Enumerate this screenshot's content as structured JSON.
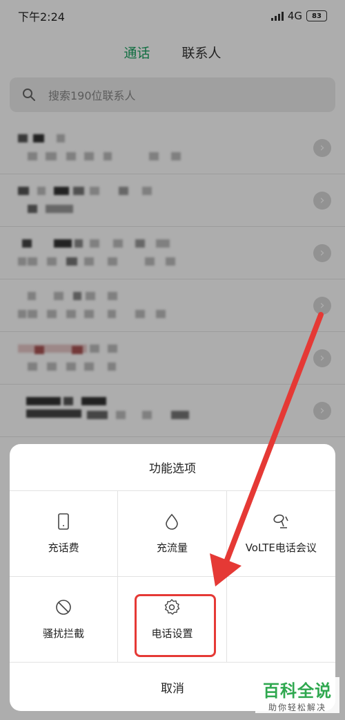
{
  "status_bar": {
    "time": "下午2:24",
    "network": "4G",
    "battery": "83"
  },
  "tabs": [
    {
      "label": "通话",
      "active": true
    },
    {
      "label": "联系人",
      "active": false
    }
  ],
  "search": {
    "placeholder": "搜索190位联系人",
    "icon": "search-icon"
  },
  "contacts": [
    {
      "name_visible": "1",
      "blurred": true
    },
    {
      "name_visible": "2",
      "blurred": true
    },
    {
      "name_visible": "1",
      "blurred": true
    },
    {
      "name_visible": "",
      "blurred": true
    },
    {
      "name_visible": "",
      "blurred": true
    },
    {
      "name_visible": "",
      "blurred": true
    }
  ],
  "sheet": {
    "title": "功能选项",
    "items": [
      {
        "label": "充话费",
        "icon": "phone-recharge-icon"
      },
      {
        "label": "充流量",
        "icon": "data-drop-icon"
      },
      {
        "label": "VoLTE电话会议",
        "icon": "conference-call-icon"
      },
      {
        "label": "骚扰拦截",
        "icon": "block-icon"
      },
      {
        "label": "电话设置",
        "icon": "settings-gear-icon"
      },
      {
        "label": "",
        "icon": ""
      }
    ],
    "cancel_label": "取消"
  },
  "highlight_color": "#e53935",
  "accent_color": "#1aa260",
  "watermark": {
    "title": "百科全说",
    "subtitle": "助你轻松解决"
  }
}
